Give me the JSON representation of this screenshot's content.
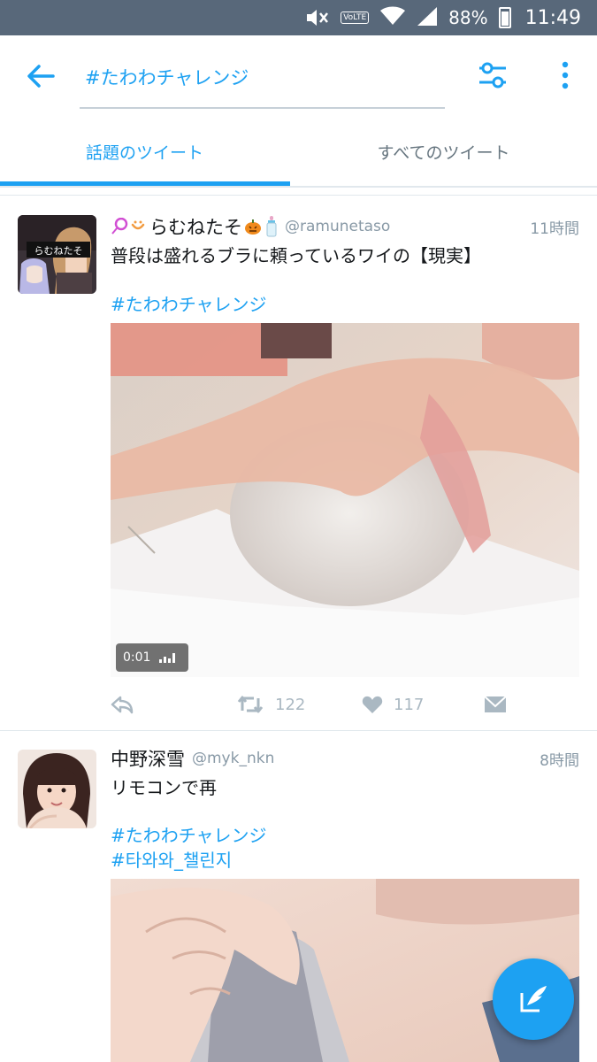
{
  "status_bar": {
    "battery": "88%",
    "time": "11:49",
    "volte": "VoLTE"
  },
  "header": {
    "search_query": "#たわわチャレンジ"
  },
  "tabs": [
    {
      "label": "話題のツイート",
      "active": true
    },
    {
      "label": "すべてのツイート",
      "active": false
    }
  ],
  "tweets": [
    {
      "display_name": "らむねたそ",
      "handle": "@ramunetaso",
      "time": "11時間",
      "text": "普段は盛れるブラに頼っているワイの【現実】",
      "hashtags": [
        "#たわわチャレンジ"
      ],
      "avatar_label": "らむねたそ",
      "media": {
        "type": "video",
        "duration": "0:01"
      },
      "retweets": "122",
      "likes": "117"
    },
    {
      "display_name": "中野深雪",
      "handle": "@myk_nkn",
      "time": "8時間",
      "text": "リモコンで再",
      "hashtags": [
        "#たわわチャレンジ",
        "#타와와_챌린지"
      ]
    }
  ],
  "colors": {
    "accent": "#1da1f2",
    "status_bar": "#58687a",
    "muted": "#8899a6",
    "action_icon": "#aab8c2"
  },
  "icons": {
    "back": "arrow-left-icon",
    "filter": "sliders-icon",
    "more": "more-vertical-icon",
    "reply": "reply-icon",
    "retweet": "retweet-icon",
    "like": "heart-icon",
    "dm": "envelope-icon",
    "compose": "compose-tweet-icon"
  }
}
